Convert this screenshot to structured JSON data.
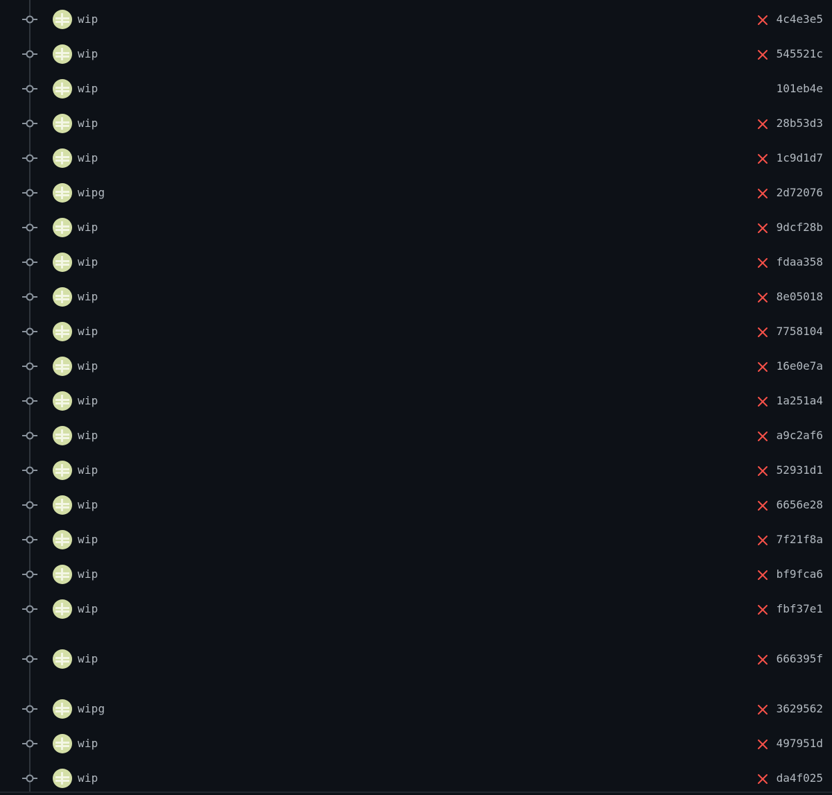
{
  "colors": {
    "background": "#0d1117",
    "timeline": "#30363d",
    "node": "#8b949e",
    "text": "#b3bac1",
    "failure": "#f85149",
    "avatar_bg": "#d4dfa7",
    "avatar_fg": "#f3f6e4"
  },
  "commits": [
    {
      "message": "wip",
      "sha": "4c4e3e5",
      "status": "failure",
      "status_icon": "x-icon"
    },
    {
      "message": "wip",
      "sha": "545521c",
      "status": "failure",
      "status_icon": "x-icon"
    },
    {
      "message": "wip",
      "sha": "101eb4e",
      "status": "none",
      "status_icon": ""
    },
    {
      "message": "wip",
      "sha": "28b53d3",
      "status": "failure",
      "status_icon": "x-icon"
    },
    {
      "message": "wip",
      "sha": "1c9d1d7",
      "status": "failure",
      "status_icon": "x-icon"
    },
    {
      "message": "wipg",
      "sha": "2d72076",
      "status": "failure",
      "status_icon": "x-icon"
    },
    {
      "message": "wip",
      "sha": "9dcf28b",
      "status": "failure",
      "status_icon": "x-icon"
    },
    {
      "message": "wip",
      "sha": "fdaa358",
      "status": "failure",
      "status_icon": "x-icon"
    },
    {
      "message": "wip",
      "sha": "8e05018",
      "status": "failure",
      "status_icon": "x-icon"
    },
    {
      "message": "wip",
      "sha": "7758104",
      "status": "failure",
      "status_icon": "x-icon"
    },
    {
      "message": "wip",
      "sha": "16e0e7a",
      "status": "failure",
      "status_icon": "x-icon"
    },
    {
      "message": "wip",
      "sha": "1a251a4",
      "status": "failure",
      "status_icon": "x-icon"
    },
    {
      "message": "wip",
      "sha": "a9c2af6",
      "status": "failure",
      "status_icon": "x-icon"
    },
    {
      "message": "wip",
      "sha": "52931d1",
      "status": "failure",
      "status_icon": "x-icon"
    },
    {
      "message": "wip",
      "sha": "6656e28",
      "status": "failure",
      "status_icon": "x-icon"
    },
    {
      "message": "wip",
      "sha": "7f21f8a",
      "status": "failure",
      "status_icon": "x-icon"
    },
    {
      "message": "wip",
      "sha": "bf9fca6",
      "status": "failure",
      "status_icon": "x-icon"
    },
    {
      "message": "wip",
      "sha": "fbf37e1",
      "status": "failure",
      "status_icon": "x-icon"
    },
    {
      "message": "wip",
      "sha": "666395f",
      "status": "failure",
      "status_icon": "x-icon"
    },
    {
      "message": "wipg",
      "sha": "3629562",
      "status": "failure",
      "status_icon": "x-icon"
    },
    {
      "message": "wip",
      "sha": "497951d",
      "status": "failure",
      "status_icon": "x-icon"
    },
    {
      "message": "wip",
      "sha": "da4f025",
      "status": "failure",
      "status_icon": "x-icon"
    }
  ]
}
